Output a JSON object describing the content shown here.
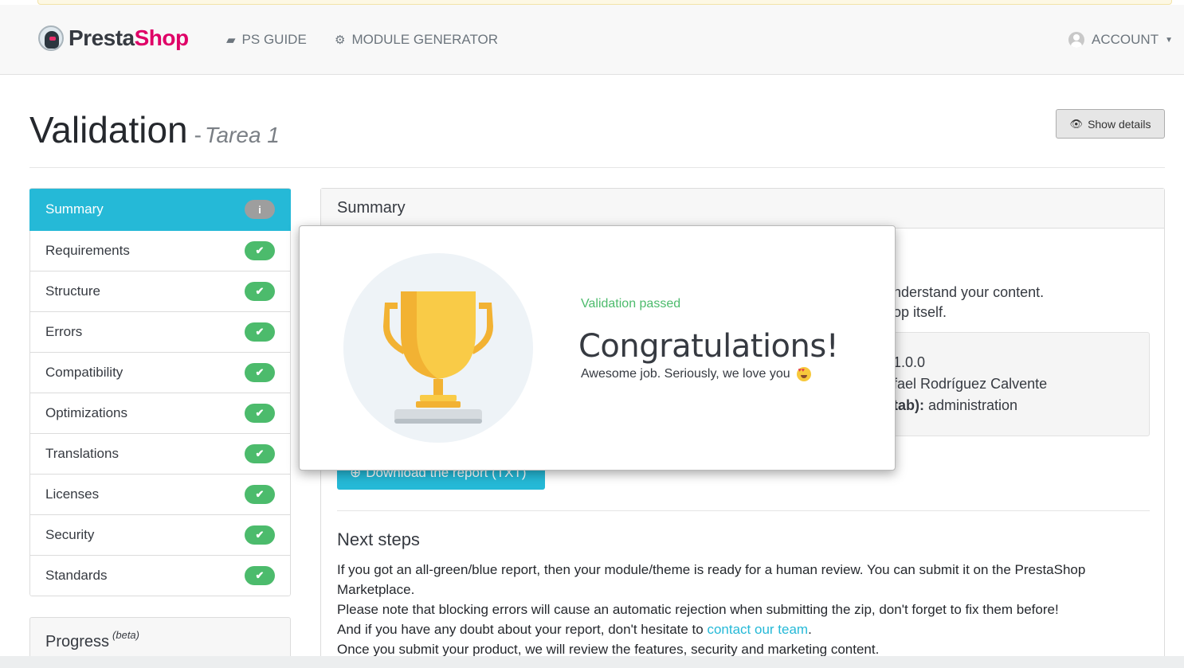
{
  "navbar": {
    "brand_part1": "Presta",
    "brand_part2": "Shop",
    "guide_label": "PS GUIDE",
    "generator_label": "MODULE GENERATOR",
    "account_label": "ACCOUNT"
  },
  "header": {
    "title": "Validation",
    "dash": "-",
    "subtitle": "Tarea 1",
    "show_details_label": "Show details"
  },
  "sidebar": {
    "items": [
      {
        "label": "Summary",
        "badge": "i"
      },
      {
        "label": "Requirements",
        "badge": "✔"
      },
      {
        "label": "Structure",
        "badge": "✔"
      },
      {
        "label": "Errors",
        "badge": "✔"
      },
      {
        "label": "Compatibility",
        "badge": "✔"
      },
      {
        "label": "Optimizations",
        "badge": "✔"
      },
      {
        "label": "Translations",
        "badge": "✔"
      },
      {
        "label": "Licenses",
        "badge": "✔"
      },
      {
        "label": "Security",
        "badge": "✔"
      },
      {
        "label": "Standards",
        "badge": "✔"
      }
    ],
    "progress_title": "Progress",
    "progress_beta": "(beta)"
  },
  "main": {
    "panel_title": "Summary",
    "partial_line1": "nderstand your content.",
    "partial_line2": "op itself.",
    "info_version": "1.0.0",
    "info_author": "fael Rodríguez Calvente",
    "info_tab_label": "tab):",
    "info_tab_value": "administration",
    "download_label": "Download the report (TXT)",
    "next_steps_title": "Next steps",
    "next_steps_line1": "If you got an all-green/blue report, then your module/theme is ready for a human review. You can submit it on the PrestaShop Marketplace.",
    "next_steps_line2": "Please note that blocking errors will cause an automatic rejection when submitting the zip, don't forget to fix them before!",
    "next_steps_line3_pre": "And if you have any doubt about your report, don't hesitate to ",
    "next_steps_link": "contact our team",
    "next_steps_line3_post": ".",
    "next_steps_line4": "Once you submit your product, we will review the features, security and marketing content."
  },
  "modal": {
    "status": "Validation passed",
    "heading": "Congratulations!",
    "text": "Awesome job. Seriously, we love you",
    "emoji_icon": "heart-eyes-emoji"
  },
  "colors": {
    "accent": "#25b9d7",
    "success": "#4cbb6c",
    "brand_pink": "#df0067",
    "trophy_gold": "#f9cb47"
  }
}
